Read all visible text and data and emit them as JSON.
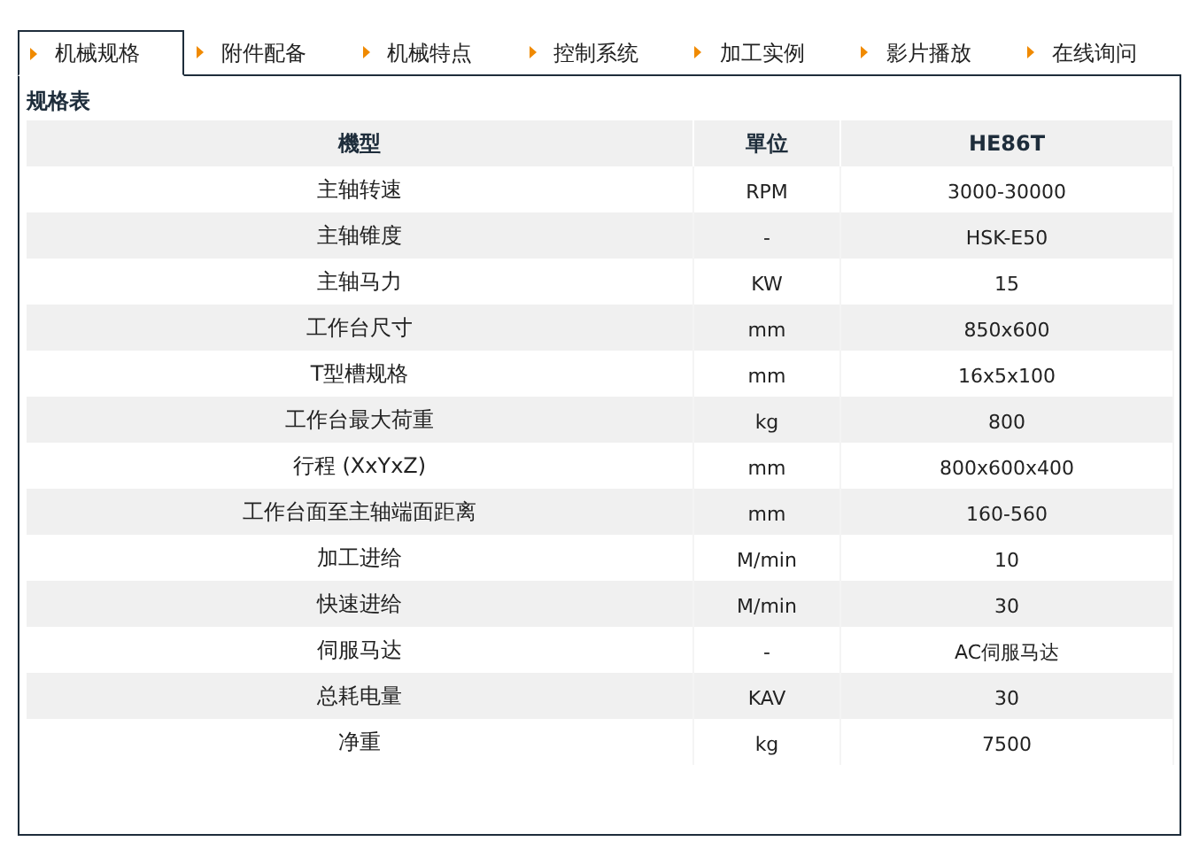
{
  "tabs": [
    {
      "label": "机械规格",
      "selected": true
    },
    {
      "label": "附件配备",
      "selected": false
    },
    {
      "label": "机械特点",
      "selected": false
    },
    {
      "label": "控制系统",
      "selected": false
    },
    {
      "label": "加工实例",
      "selected": false
    },
    {
      "label": "影片播放",
      "selected": false
    },
    {
      "label": "在线询问",
      "selected": false
    }
  ],
  "section_title": "规格表",
  "table": {
    "columns": [
      "機型",
      "單位",
      "HE86T"
    ],
    "rows": [
      [
        "主轴转速",
        "RPM",
        "3000-30000"
      ],
      [
        "主轴锥度",
        "-",
        "HSK-E50"
      ],
      [
        "主轴马力",
        "KW",
        "15"
      ],
      [
        "工作台尺寸",
        "mm",
        "850x600"
      ],
      [
        "T型槽规格",
        "mm",
        "16x5x100"
      ],
      [
        "工作台最大荷重",
        "kg",
        "800"
      ],
      [
        "行程 (XxYxZ)",
        "mm",
        "800x600x400"
      ],
      [
        "工作台面至主轴端面距离",
        "mm",
        "160-560"
      ],
      [
        "加工进给",
        "M/min",
        "10"
      ],
      [
        "快速进给",
        "M/min",
        "30"
      ],
      [
        "伺服马达",
        "-",
        "AC伺服马达"
      ],
      [
        "总耗电量",
        "KAV",
        "30"
      ],
      [
        "净重",
        "kg",
        "7500"
      ]
    ]
  }
}
